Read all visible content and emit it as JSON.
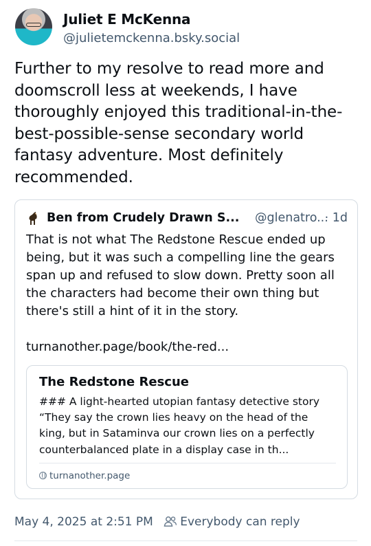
{
  "author": {
    "display_name": "Juliet E McKenna",
    "handle": "@julietemckenna.bsky.social"
  },
  "post": {
    "text": "Further to my resolve to read more and doomscroll less at weekends, I have thoroughly enjoyed this traditional-in-the-best-possible-sense secondary world fantasy adventure. Most definitely recommended.",
    "timestamp": "May 4, 2025 at 2:51 PM",
    "reply_setting": "Everybody can reply"
  },
  "quoted_post": {
    "author_name": "Ben from Crudely Drawn S...",
    "author_handle": "@glenatro...",
    "separator": "·",
    "age": "1d",
    "text": "That is not what The Redstone Rescue ended up being, but it was such a compelling line the gears span up and refused to slow down. Pretty soon all the characters had become their own thing but there's still a hint of it in the story.",
    "link": "turnanother.page/book/the-red..."
  },
  "link_card": {
    "title": "The Redstone Rescue",
    "description": "### A light-hearted utopian fantasy detective story “They say the crown lies heavy on the head of the king, but in Sataminva our crown lies on a perfectly counterbalanced plate in a display case in th...",
    "domain": "turnanother.page",
    "domain_icon": "globe-icon"
  },
  "icons": {
    "reply_setting_icon": "people-icon",
    "quoted_avatar": "horse-icon"
  },
  "colors": {
    "text": "#0b0f14",
    "secondary": "#42576c",
    "border": "#d4dbe2"
  }
}
